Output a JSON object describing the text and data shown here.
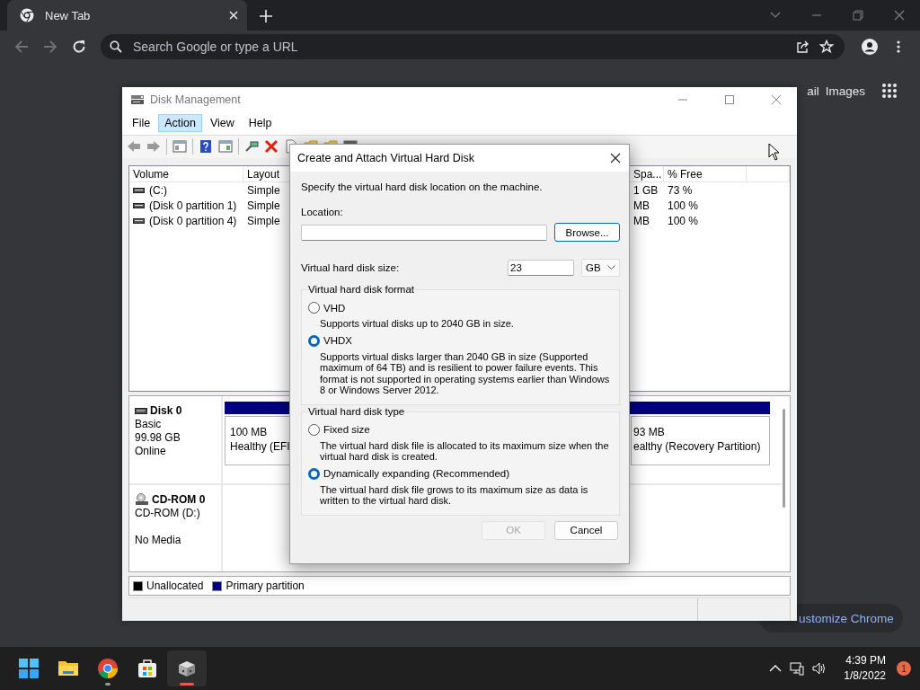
{
  "browser": {
    "tab": {
      "title": "New Tab",
      "selected": true
    },
    "address_bar": {
      "placeholder": "Search Google or type a URL"
    },
    "header_links": [
      "ail",
      "Images"
    ],
    "customize_button": "ustomize Chrome"
  },
  "disk_management": {
    "title": "Disk Management",
    "menu": [
      {
        "label": "File",
        "selected": false
      },
      {
        "label": "Action",
        "selected": true
      },
      {
        "label": "View",
        "selected": false
      },
      {
        "label": "Help",
        "selected": false
      }
    ],
    "volume_list": {
      "columns": [
        "Volume",
        "Layout",
        "Spa...",
        "% Free"
      ],
      "rows": [
        {
          "volume": "(C:)",
          "layout": "Simple",
          "space": "1 GB",
          "free": "73 %"
        },
        {
          "volume": "(Disk 0 partition 1)",
          "layout": "Simple",
          "space": "MB",
          "free": "100 %"
        },
        {
          "volume": "(Disk 0 partition 4)",
          "layout": "Simple",
          "space": "MB",
          "free": "100 %"
        }
      ]
    },
    "disks": [
      {
        "kind": "disk",
        "name": "Disk 0",
        "type": "Basic",
        "size": "99.98 GB",
        "status": "Online",
        "partitions": [
          {
            "size": "100 MB",
            "status": "Healthy (EFI"
          },
          {
            "size": "93 MB",
            "status": "ealthy (Recovery Partition)"
          }
        ]
      },
      {
        "kind": "cdrom",
        "name": "CD-ROM 0",
        "type": "CD-ROM (D:)",
        "status": "No Media"
      }
    ],
    "legend": [
      {
        "label": "Unallocated",
        "color": "#000000"
      },
      {
        "label": "Primary partition",
        "color": "#000080"
      }
    ]
  },
  "dialog": {
    "title": "Create and Attach Virtual Hard Disk",
    "intro": "Specify the virtual hard disk location on the machine.",
    "location": {
      "label": "Location:"
    },
    "browse_button": "Browse...",
    "size": {
      "label": "Virtual hard disk size:",
      "value": "23",
      "unit": "GB"
    },
    "format": {
      "label": "Virtual hard disk format",
      "options": [
        {
          "label": "VHD",
          "description": "Supports virtual disks up to 2040 GB in size.",
          "selected": false
        },
        {
          "label": "VHDX",
          "description": "Supports virtual disks larger than 2040 GB in size (Supported maximum of 64 TB) and is resilient to power failure events. This format is not supported in operating systems earlier than Windows 8 or Windows Server 2012.",
          "selected": true
        }
      ]
    },
    "type": {
      "label": "Virtual hard disk type",
      "options": [
        {
          "label": "Fixed size",
          "description": "The virtual hard disk file is allocated to its maximum size when the virtual hard disk is created.",
          "selected": false
        },
        {
          "label": "Dynamically expanding (Recommended)",
          "description": "The virtual hard disk file grows to its maximum size as data is written to the virtual hard disk.",
          "selected": true
        }
      ]
    },
    "buttons": [
      {
        "label": "OK",
        "disabled": true
      },
      {
        "label": "Cancel",
        "disabled": false
      }
    ]
  },
  "taskbar": {
    "apps": [
      {
        "kind": "start",
        "running": false,
        "selected": false
      },
      {
        "kind": "explorer",
        "running": false,
        "selected": false
      },
      {
        "kind": "chrome",
        "running": true,
        "selected": false
      },
      {
        "kind": "store",
        "running": false,
        "selected": false
      },
      {
        "kind": "disk",
        "running": true,
        "selected": true
      }
    ],
    "time": "4:39 PM",
    "date": "1/8/2022",
    "notification_count": "1"
  }
}
